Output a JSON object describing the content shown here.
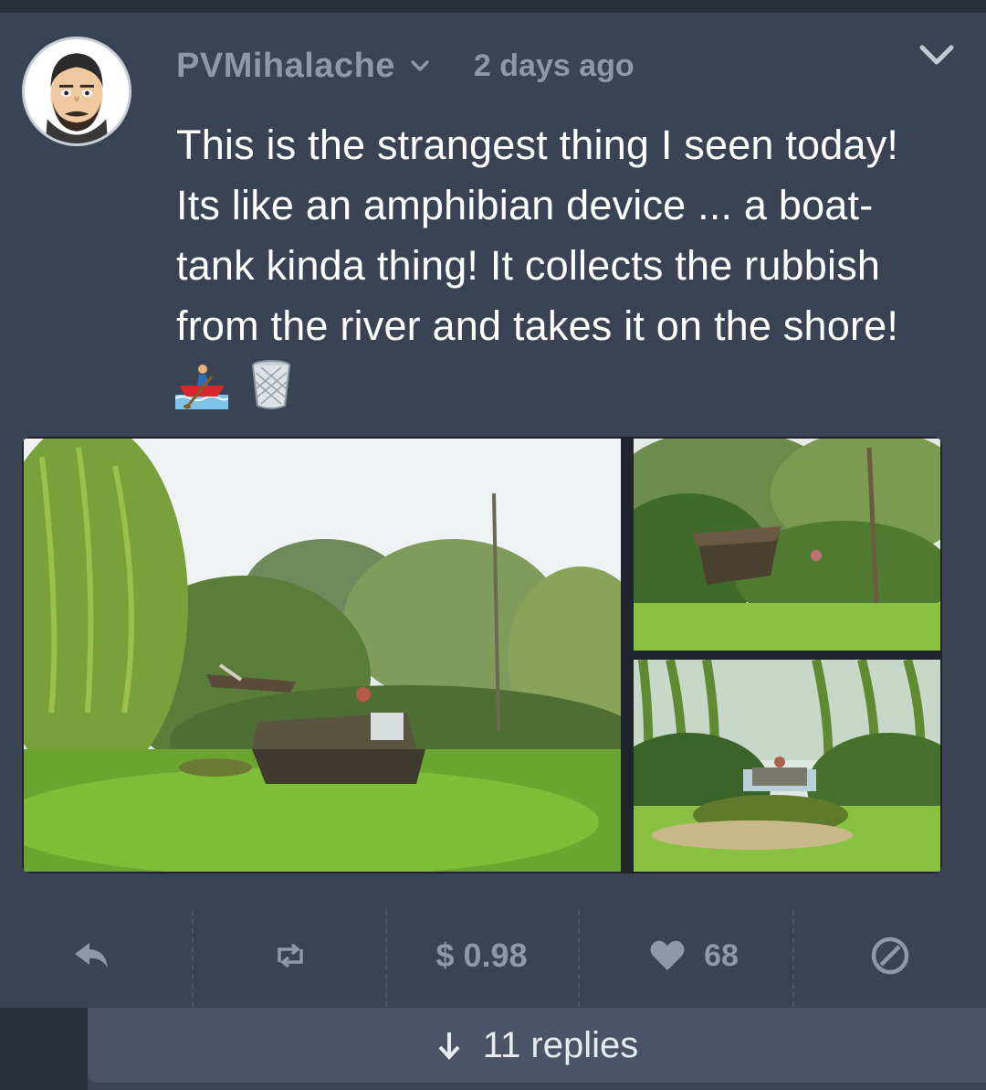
{
  "colors": {
    "background": "#3a4354",
    "muted_text": "#8f98a8",
    "post_text": "#ffffff",
    "replies_bar": "#4b5466"
  },
  "post": {
    "author": "PVMihalache",
    "timestamp": "2 days ago",
    "body_lines": [
      "This is the strangest thing I seen today!",
      "Its like an amphibian device ... a boat-",
      "tank kinda thing! It collects the rubbish",
      "from the river and takes it on the shore!"
    ],
    "emojis": [
      "rowboat-emoji",
      "wastebasket-emoji"
    ]
  },
  "gallery": {
    "photos": [
      "amphibious-boat-on-grass-photo",
      "boat-behind-bushes-photo",
      "boat-under-willow-photo"
    ]
  },
  "actions": {
    "payout": "$ 0.98",
    "votes": "68"
  },
  "replies": {
    "label": "11 replies"
  }
}
